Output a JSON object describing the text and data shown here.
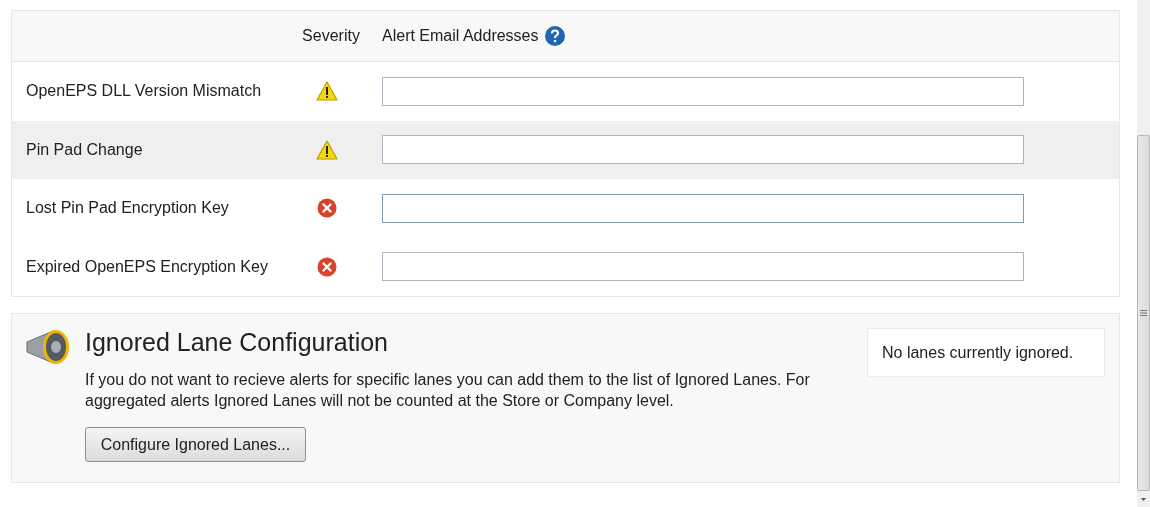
{
  "alerts_table": {
    "columns": [
      "Severity",
      "Alert Email Addresses"
    ],
    "rows": [
      {
        "name": "OpenEPS DLL Version Mismatch",
        "kind": "warning",
        "highlighted": false,
        "focused": false
      },
      {
        "name": "Pin Pad Change",
        "kind": "warning",
        "highlighted": true,
        "focused": false
      },
      {
        "name": "Lost Pin Pad Encryption Key",
        "kind": "error",
        "highlighted": false,
        "focused": true
      },
      {
        "name": "Expired OpenEPS Encryption Key",
        "kind": "error",
        "highlighted": false,
        "focused": false
      }
    ]
  },
  "ignored_lanes": {
    "title": "Ignored Lane Configuration",
    "description": "If you do not want to recieve alerts for specific lanes you can add them to the list of Ignored Lanes. For aggregated alerts Ignored Lanes will not be counted at the Store or Company level.",
    "button": "Configure Ignored Lanes...",
    "status": "No lanes currently ignored."
  }
}
